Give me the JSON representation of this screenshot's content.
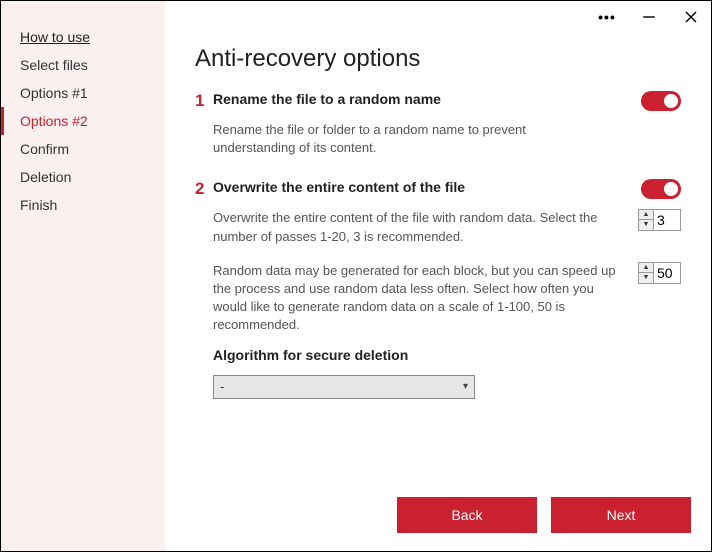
{
  "sidebar": {
    "items": [
      {
        "label": "How to use"
      },
      {
        "label": "Select files"
      },
      {
        "label": "Options #1"
      },
      {
        "label": "Options #2"
      },
      {
        "label": "Confirm"
      },
      {
        "label": "Deletion"
      },
      {
        "label": "Finish"
      }
    ]
  },
  "page": {
    "title": "Anti-recovery options"
  },
  "section1": {
    "num": "1",
    "title": "Rename the file to a random name",
    "desc": "Rename the file or folder to a random name to prevent understanding of its content."
  },
  "section2": {
    "num": "2",
    "title": "Overwrite the entire content of the file",
    "desc1": "Overwrite the entire content of the file with random data. Select the number of passes 1-20, 3 is recommended.",
    "passes": "3",
    "desc2": "Random data may be generated for each block, but you can speed up the process and use random data less often. Select how often you would like to generate random data on a scale of 1-100, 50 is recommended.",
    "freq": "50"
  },
  "algo": {
    "label": "Algorithm for secure deletion",
    "selected": "-"
  },
  "footer": {
    "back": "Back",
    "next": "Next"
  }
}
